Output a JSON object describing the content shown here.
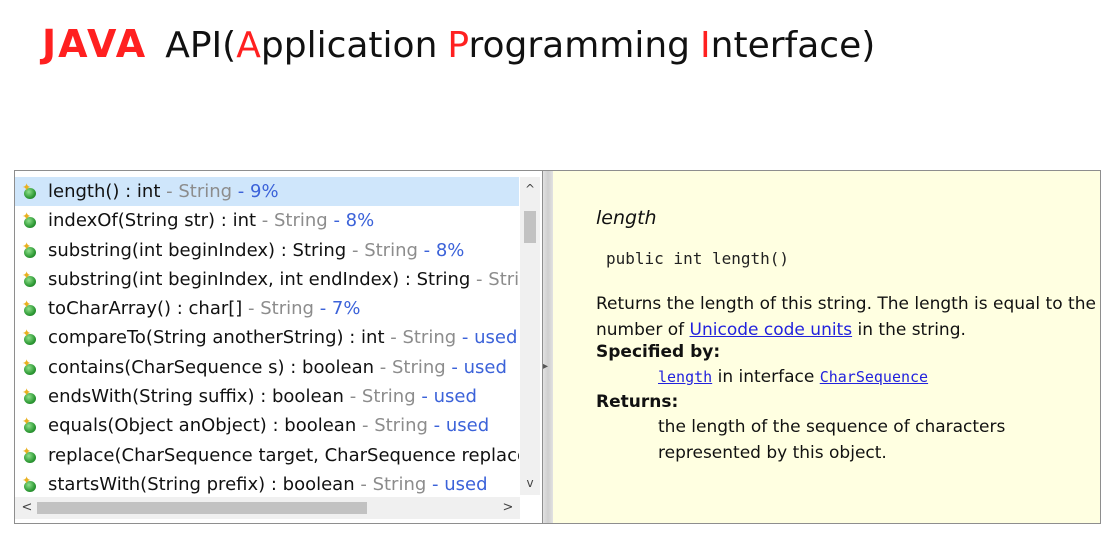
{
  "title": {
    "java": "JAVA",
    "api_prefix": "API(",
    "a_letter": "A",
    "a_rest": "pplication",
    "p_letter": "P",
    "p_rest": "rogramming",
    "i_letter": "I",
    "i_rest": "nterface)"
  },
  "colors": {
    "accent_red": "#ff2020",
    "selection": "#cfe6fb",
    "doc_background": "#ffffe1",
    "link": "#2222dd",
    "relevance_blue": "#3b62d9"
  },
  "completion_list": [
    {
      "method": "length() : int",
      "sep1": " - ",
      "type": "String",
      "sep2": " - ",
      "info": "9%",
      "selected": true,
      "icon": "public-method-icon"
    },
    {
      "method": "indexOf(String str) : int",
      "sep1": " - ",
      "type": "String",
      "sep2": " - ",
      "info": "8%",
      "selected": false,
      "icon": "public-method-icon"
    },
    {
      "method": "substring(int beginIndex) : String",
      "sep1": " - ",
      "type": "String",
      "sep2": " - ",
      "info": "8%",
      "selected": false,
      "icon": "public-method-icon"
    },
    {
      "method": "substring(int beginIndex, int endIndex) : String",
      "sep1": " - ",
      "type": "String",
      "sep2": " -",
      "info": "",
      "selected": false,
      "icon": "public-method-icon"
    },
    {
      "method": "toCharArray() : char[]",
      "sep1": " - ",
      "type": "String",
      "sep2": " - ",
      "info": "7%",
      "selected": false,
      "icon": "public-method-icon"
    },
    {
      "method": "compareTo(String anotherString) : int",
      "sep1": " - ",
      "type": "String",
      "sep2": " - ",
      "info": "used",
      "selected": false,
      "icon": "public-method-icon"
    },
    {
      "method": "contains(CharSequence s) : boolean",
      "sep1": " - ",
      "type": "String",
      "sep2": " - ",
      "info": "used",
      "selected": false,
      "icon": "public-method-icon"
    },
    {
      "method": "endsWith(String suffix) : boolean",
      "sep1": " - ",
      "type": "String",
      "sep2": " - ",
      "info": "used",
      "selected": false,
      "icon": "public-method-icon"
    },
    {
      "method": "equals(Object anObject) : boolean",
      "sep1": " - ",
      "type": "String",
      "sep2": " - ",
      "info": "used",
      "selected": false,
      "icon": "public-method-icon"
    },
    {
      "method": "replace(CharSequence target, CharSequence replacemer",
      "sep1": "",
      "type": "",
      "sep2": "",
      "info": "",
      "selected": false,
      "icon": "public-method-icon"
    },
    {
      "method": "startsWith(String prefix) : boolean",
      "sep1": " - ",
      "type": "String",
      "sep2": " - ",
      "info": "used",
      "selected": false,
      "icon": "public-method-icon"
    }
  ],
  "scrollbar": {
    "up_arrow": "^",
    "down_arrow": "v",
    "left_arrow": "<",
    "right_arrow": ">"
  },
  "doc": {
    "name": "length",
    "signature": "public int length()",
    "desc_line1": "Returns the length of this string. The length is equal to the",
    "desc_line2_pre": "number of ",
    "desc_link": "Unicode code units",
    "desc_line2_post": " in the string.",
    "specified_label": "Specified by:",
    "specified_method": "length",
    "specified_mid": " in interface ",
    "specified_interface": "CharSequence",
    "returns_label": "Returns:",
    "returns_line1": "the length of the sequence of characters",
    "returns_line2": "represented by this object."
  }
}
